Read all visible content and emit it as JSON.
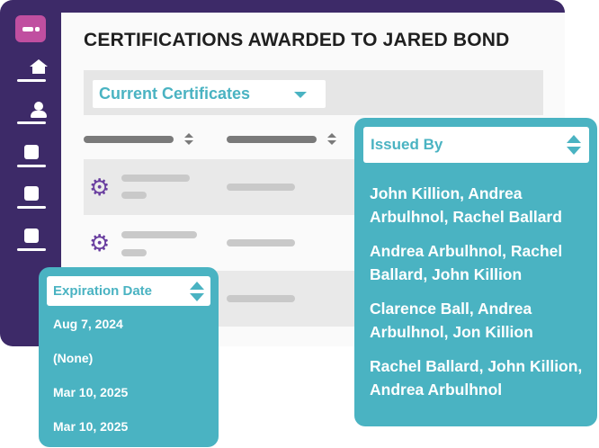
{
  "page": {
    "title": "CERTIFICATIONS AWARDED TO JARED BOND"
  },
  "colors": {
    "sidebar": "#3d2a68",
    "accent": "#4ab3c2",
    "logo": "#c04fa0",
    "gear": "#6a3fa0"
  },
  "sidebar": {
    "logo": "app-logo",
    "items": [
      {
        "icon": "home-icon"
      },
      {
        "icon": "user-icon"
      },
      {
        "icon": "document-icon"
      },
      {
        "icon": "document-icon"
      },
      {
        "icon": "document-icon"
      }
    ]
  },
  "filter": {
    "selected": "Current Certificates"
  },
  "table": {
    "row_icon": "gear-icon"
  },
  "issued_by": {
    "header": "Issued By",
    "items": [
      "John Killion, Andrea Arbulhnol, Rachel Ballard",
      "Andrea Arbulhnol, Rachel Ballard, John Killion",
      "Clarence Ball, Andrea Arbulhnol, Jon Killion",
      "Rachel Ballard, John Killion, Andrea Arbulhnol"
    ]
  },
  "expiration": {
    "header": "Expiration Date",
    "items": [
      "Aug 7, 2024",
      "(None)",
      "Mar 10, 2025",
      "Mar 10, 2025"
    ]
  }
}
